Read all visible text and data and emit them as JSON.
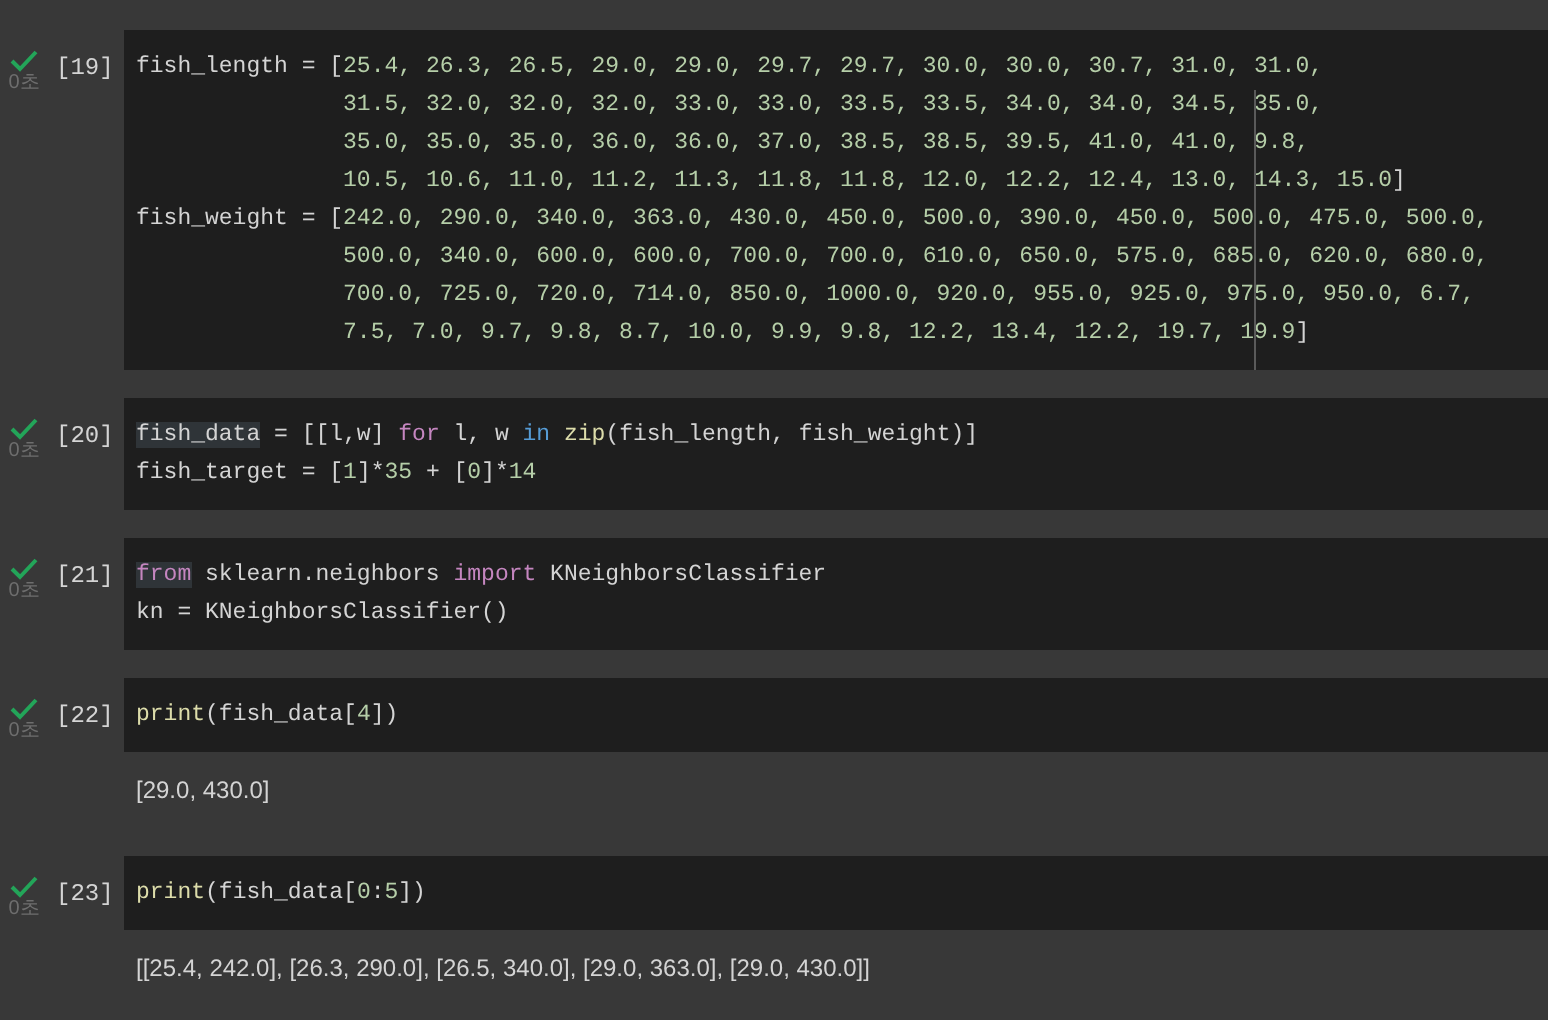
{
  "cells": [
    {
      "count": "[19]",
      "status_time": "0초",
      "succeeded": true,
      "lines": [
        {
          "continuation": false,
          "tokens": [
            {
              "text": "fish_length = [",
              "kind": "plain",
              "highlighted": false
            },
            {
              "text": "25.4, 26.3, 26.5, 29.0, 29.0, 29.7, 29.7, 30.0, 30.0, 30.7, 31.0, 31.0,",
              "kind": "number",
              "highlighted": false
            }
          ]
        },
        {
          "continuation": true,
          "tokens": [
            {
              "text": "31.5, 32.0, 32.0, 32.0, 33.0, 33.0, 33.5, 33.5, 34.0, 34.0, 34.5, 35.0,",
              "kind": "number",
              "highlighted": false
            }
          ]
        },
        {
          "continuation": true,
          "tokens": [
            {
              "text": "35.0, 35.0, 35.0, 36.0, 36.0, 37.0, 38.5, 38.5, 39.5, 41.0, 41.0, 9.8,",
              "kind": "number",
              "highlighted": false
            }
          ]
        },
        {
          "continuation": true,
          "tokens": [
            {
              "text": "10.5, 10.6, 11.0, 11.2, 11.3, 11.8, 11.8, 12.0, 12.2, 12.4, 13.0, 14.3, 15.0",
              "kind": "number",
              "highlighted": false
            },
            {
              "text": "]",
              "kind": "plain",
              "highlighted": false
            }
          ]
        },
        {
          "continuation": false,
          "tokens": [
            {
              "text": "fish_weight = [",
              "kind": "plain",
              "highlighted": false
            },
            {
              "text": "242.0, 290.0, 340.0, 363.0, 430.0, 450.0, 500.0, 390.0, 450.0, 500.0, 475.0, 500.0,",
              "kind": "number",
              "highlighted": false
            }
          ]
        },
        {
          "continuation": true,
          "tokens": [
            {
              "text": "500.0, 340.0, 600.0, 600.0, 700.0, 700.0, 610.0, 650.0, 575.0, 685.0, 620.0, 680.0,",
              "kind": "number",
              "highlighted": false
            }
          ]
        },
        {
          "continuation": true,
          "tokens": [
            {
              "text": "700.0, 725.0, 720.0, 714.0, 850.0, 1000.0, 920.0, 955.0, 925.0, 975.0, 950.0, 6.7,",
              "kind": "number",
              "highlighted": false
            }
          ]
        },
        {
          "continuation": true,
          "tokens": [
            {
              "text": "7.5, 7.0, 9.7, 9.8, 8.7, 10.0, 9.9, 9.8, 12.2, 13.4, 12.2, 19.7, 19.9",
              "kind": "number",
              "highlighted": false
            },
            {
              "text": "]",
              "kind": "plain",
              "highlighted": false
            }
          ]
        }
      ]
    },
    {
      "count": "[20]",
      "status_time": "0초",
      "succeeded": true,
      "lines": [
        {
          "continuation": false,
          "tokens": [
            {
              "text": "fish_data",
              "kind": "plain",
              "highlighted": true
            },
            {
              "text": " = [[l,w] ",
              "kind": "plain",
              "highlighted": false
            },
            {
              "text": "for",
              "kind": "control",
              "highlighted": false
            },
            {
              "text": " l, w ",
              "kind": "plain",
              "highlighted": false
            },
            {
              "text": "in",
              "kind": "operator",
              "highlighted": false
            },
            {
              "text": " zip",
              "kind": "function",
              "highlighted": false
            },
            {
              "text": "(fish_length, fish_weight)]",
              "kind": "plain",
              "highlighted": false
            }
          ]
        },
        {
          "continuation": false,
          "tokens": [
            {
              "text": "fish_target = [",
              "kind": "plain",
              "highlighted": false
            },
            {
              "text": "1",
              "kind": "number",
              "highlighted": false
            },
            {
              "text": "]*",
              "kind": "plain",
              "highlighted": false
            },
            {
              "text": "35",
              "kind": "number",
              "highlighted": false
            },
            {
              "text": " + [",
              "kind": "plain",
              "highlighted": false
            },
            {
              "text": "0",
              "kind": "number",
              "highlighted": false
            },
            {
              "text": "]*",
              "kind": "plain",
              "highlighted": false
            },
            {
              "text": "14",
              "kind": "number",
              "highlighted": false
            }
          ]
        }
      ]
    },
    {
      "count": "[21]",
      "status_time": "0초",
      "succeeded": true,
      "lines": [
        {
          "continuation": false,
          "tokens": [
            {
              "text": "from",
              "kind": "control",
              "highlighted": true
            },
            {
              "text": " sklearn.neighbors ",
              "kind": "plain",
              "highlighted": false
            },
            {
              "text": "import",
              "kind": "control",
              "highlighted": false
            },
            {
              "text": " KNeighborsClassifier",
              "kind": "plain",
              "highlighted": false
            }
          ]
        },
        {
          "continuation": false,
          "tokens": [
            {
              "text": "kn = KNeighborsClassifier()",
              "kind": "plain",
              "highlighted": false
            }
          ]
        }
      ]
    },
    {
      "count": "[22]",
      "status_time": "0초",
      "succeeded": true,
      "lines": [
        {
          "continuation": false,
          "tokens": [
            {
              "text": "print",
              "kind": "function",
              "highlighted": false
            },
            {
              "text": "(fish_data[",
              "kind": "plain",
              "highlighted": false
            },
            {
              "text": "4",
              "kind": "number",
              "highlighted": false
            },
            {
              "text": "])",
              "kind": "plain",
              "highlighted": false
            }
          ]
        }
      ],
      "outputs": [
        "[29.0, 430.0]"
      ]
    },
    {
      "count": "[23]",
      "status_time": "0초",
      "succeeded": true,
      "lines": [
        {
          "continuation": false,
          "tokens": [
            {
              "text": "print",
              "kind": "function",
              "highlighted": false
            },
            {
              "text": "(fish_data[",
              "kind": "plain",
              "highlighted": false
            },
            {
              "text": "0",
              "kind": "number",
              "highlighted": false
            },
            {
              "text": ":",
              "kind": "plain",
              "highlighted": false
            },
            {
              "text": "5",
              "kind": "number",
              "highlighted": false
            },
            {
              "text": "])",
              "kind": "plain",
              "highlighted": false
            }
          ]
        }
      ],
      "outputs": [
        "[[25.4, 242.0], [26.3, 290.0], [26.5, 340.0], [29.0, 363.0], [29.0, 430.0]]"
      ]
    }
  ]
}
